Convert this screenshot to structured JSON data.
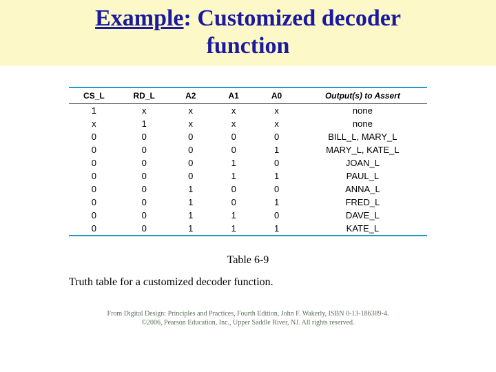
{
  "title": {
    "underlined": "Example",
    "after_colon": ": Customized decoder",
    "line2": "function"
  },
  "table": {
    "headers": [
      "CS_L",
      "RD_L",
      "A2",
      "A1",
      "A0",
      "Output(s) to Assert"
    ],
    "rows": [
      {
        "c": [
          "1",
          "x",
          "x",
          "x",
          "x"
        ],
        "out": "none"
      },
      {
        "c": [
          "x",
          "1",
          "x",
          "x",
          "x"
        ],
        "out": "none"
      },
      {
        "c": [
          "0",
          "0",
          "0",
          "0",
          "0"
        ],
        "out": "BILL_L, MARY_L"
      },
      {
        "c": [
          "0",
          "0",
          "0",
          "0",
          "1"
        ],
        "out": "MARY_L, KATE_L"
      },
      {
        "c": [
          "0",
          "0",
          "0",
          "1",
          "0"
        ],
        "out": "JOAN_L"
      },
      {
        "c": [
          "0",
          "0",
          "0",
          "1",
          "1"
        ],
        "out": "PAUL_L"
      },
      {
        "c": [
          "0",
          "0",
          "1",
          "0",
          "0"
        ],
        "out": "ANNA_L"
      },
      {
        "c": [
          "0",
          "0",
          "1",
          "0",
          "1"
        ],
        "out": "FRED_L"
      },
      {
        "c": [
          "0",
          "0",
          "1",
          "1",
          "0"
        ],
        "out": "DAVE_L"
      },
      {
        "c": [
          "0",
          "0",
          "1",
          "1",
          "1"
        ],
        "out": "KATE_L"
      }
    ]
  },
  "caption": {
    "table_label": "Table 6-9",
    "description": "Truth table for a customized decoder function."
  },
  "credit": {
    "line1": "From Digital Design: Principles and Practices, Fourth Edition, John F. Wakerly, ISBN 0-13-186389-4.",
    "line2": "©2006, Pearson Education, Inc., Upper Saddle River, NJ. All rights reserved."
  }
}
